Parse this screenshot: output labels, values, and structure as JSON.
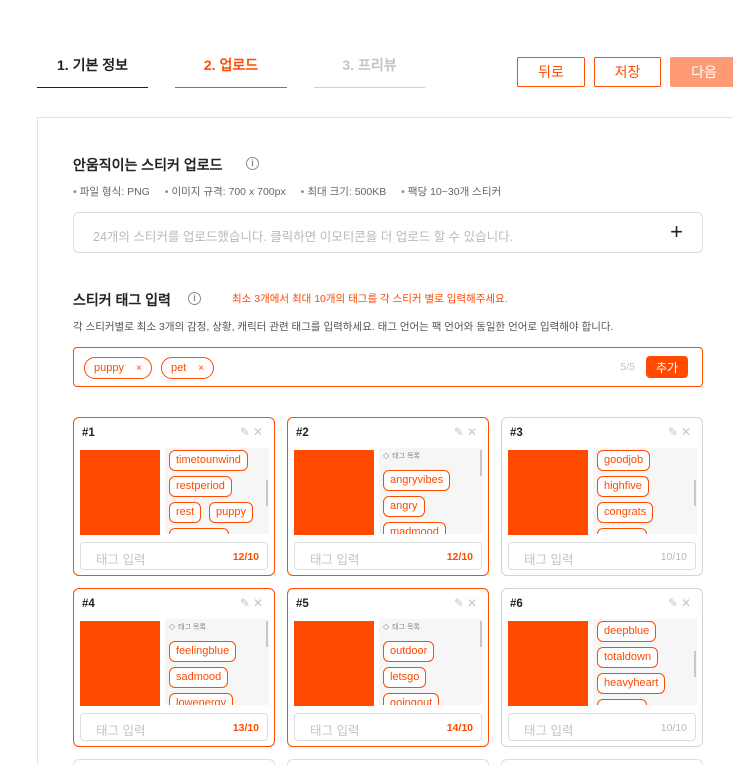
{
  "steps": [
    {
      "label": "1. 기본 정보"
    },
    {
      "label": "2. 업로드"
    },
    {
      "label": "3. 프리뷰"
    }
  ],
  "actions": {
    "back": "뒤로",
    "save": "저장",
    "next": "다음"
  },
  "upload": {
    "title": "안움직이는 스티커 업로드",
    "specs": [
      "파일 형식: PNG",
      "이미지 규격: 700 x 700px",
      "최대 크기: 500KB",
      "팩당 10~30개 스티커"
    ],
    "placeholder": "24개의 스티커를 업로드했습니다. 클릭하면 이모티콘을 더 업로드 할 수 있습니다.",
    "plus": "+"
  },
  "tags": {
    "title": "스티커 태그 입력",
    "warning": "최소 3개에서 최대 10개의 태그를 각 스티커 별로 입력해주세요.",
    "help": "각 스티커별로 최소 3개의 감정, 상황, 캐릭터 관련 태그를 입력하세요. 태그 언어는 팩 언어와 동일한 언어로 입력해야 합니다.",
    "chips": [
      "puppy",
      "pet"
    ],
    "counter": "5/5",
    "add_label": "추가",
    "chip_remove": "×"
  },
  "card_common": {
    "input_placeholder": "태그 입력",
    "tag_list_label": "태그 목록",
    "edit_icon": "✎",
    "close_icon": "✕"
  },
  "cards": [
    {
      "num": "#1",
      "count": "12/10",
      "tags": [
        "timetounwind",
        "restperiod",
        "rest",
        "puppy"
      ]
    },
    {
      "num": "#2",
      "count": "12/10",
      "tags": [
        "angryvibes",
        "angry",
        "madmood"
      ]
    },
    {
      "num": "#3",
      "count": "10/10",
      "tags": [
        "goodjob",
        "highfive",
        "congrats"
      ]
    },
    {
      "num": "#4",
      "count": "13/10",
      "tags": [
        "feelingblue",
        "sadmood",
        "lowenergy"
      ]
    },
    {
      "num": "#5",
      "count": "14/10",
      "tags": [
        "outdoor",
        "letsgo",
        "goingout"
      ]
    },
    {
      "num": "#6",
      "count": "10/10",
      "tags": [
        "deepblue",
        "totaldown",
        "heavyheart"
      ]
    }
  ]
}
